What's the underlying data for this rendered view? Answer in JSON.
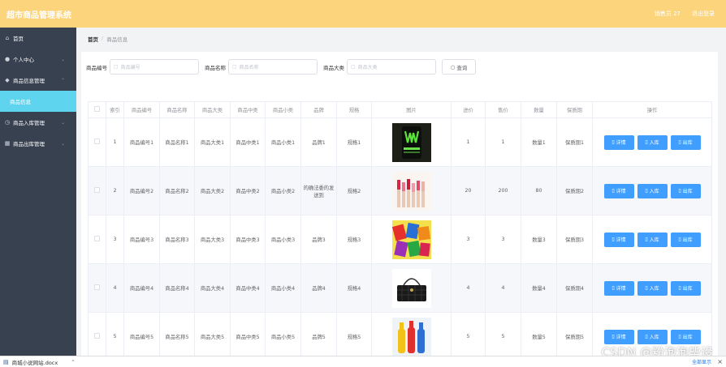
{
  "app": {
    "title": "超市商品管理系统"
  },
  "header": {
    "user": "销售员 27",
    "logout": "退出登录"
  },
  "sidebar": {
    "items": [
      {
        "label": "首页",
        "icon": "home-icon"
      },
      {
        "label": "个人中心",
        "icon": "user-icon"
      },
      {
        "label": "商品信息管理",
        "icon": "tag-icon"
      },
      {
        "label": "商品信息",
        "icon": ""
      },
      {
        "label": "商品入库管理",
        "icon": "clock-icon"
      },
      {
        "label": "商品出库管理",
        "icon": "grid-icon"
      }
    ]
  },
  "breadcrumb": {
    "home": "首页",
    "separator": "/",
    "current": "商品信息"
  },
  "search": {
    "code_label": "商品编号",
    "code_placeholder": "商品编号",
    "name_label": "商品名称",
    "name_placeholder": "商品名称",
    "category_label": "商品大类",
    "category_placeholder": "商品大类",
    "button": "查询"
  },
  "table": {
    "headers": [
      "索引",
      "商品编号",
      "商品名称",
      "商品大类",
      "商品中类",
      "商品小类",
      "品牌",
      "规格",
      "图片",
      "进价",
      "售价",
      "数量",
      "保质期",
      "操作"
    ],
    "rows": [
      {
        "index": "1",
        "code": "商品编号1",
        "name": "商品名称1",
        "big": "商品大类1",
        "mid": "商品中类1",
        "small": "商品小类1",
        "brand": "品牌1",
        "spec": "规格1",
        "image": "energy-drink-can",
        "cost": "1",
        "price": "1",
        "qty": "数量1",
        "shelf": "保质期1"
      },
      {
        "index": "2",
        "code": "商品编号2",
        "name": "商品名称2",
        "big": "商品大类2",
        "mid": "商品中类2",
        "small": "商品小类2",
        "brand": "的确法委的发送到",
        "spec": "规格2",
        "image": "lipsticks",
        "cost": "20",
        "price": "200",
        "qty": "80",
        "shelf": "保质期2"
      },
      {
        "index": "3",
        "code": "商品编号3",
        "name": "商品名称3",
        "big": "商品大类3",
        "mid": "商品中类3",
        "small": "商品小类3",
        "brand": "品牌3",
        "spec": "规格3",
        "image": "colorful-snacks",
        "cost": "3",
        "price": "3",
        "qty": "数量3",
        "shelf": "保质期3"
      },
      {
        "index": "4",
        "code": "商品编号4",
        "name": "商品名称4",
        "big": "商品大类4",
        "mid": "商品中类4",
        "small": "商品小类4",
        "brand": "品牌4",
        "spec": "规格4",
        "image": "black-handbag",
        "cost": "4",
        "price": "4",
        "qty": "数量4",
        "shelf": "保质期4"
      },
      {
        "index": "5",
        "code": "商品编号5",
        "name": "商品名称5",
        "big": "商品大类5",
        "mid": "商品中类5",
        "small": "商品小类5",
        "brand": "品牌5",
        "spec": "规格5",
        "image": "colored-bottles",
        "cost": "5",
        "price": "5",
        "qty": "数量5",
        "shelf": "保质期5"
      }
    ],
    "actions": {
      "detail": "详情",
      "stock_in": "入库",
      "stock_out": "出库"
    }
  },
  "watermark": "CSDN @粉泡泡毕设",
  "download_bar": {
    "file": "商城小说网站.docx",
    "show_all": "全部显示"
  },
  "colors": {
    "header": "#fcd47c",
    "sidebar": "#374150",
    "active_menu": "#5fd4ef",
    "primary_button": "#409eff"
  }
}
